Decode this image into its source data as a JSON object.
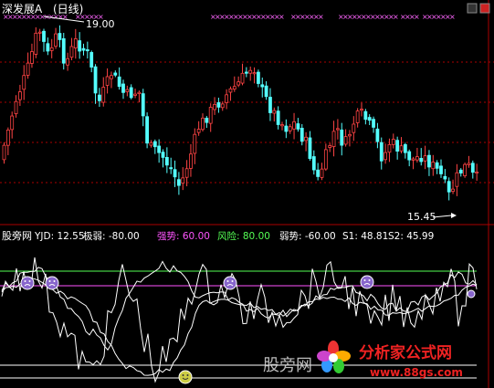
{
  "main": {
    "title": "深发展A",
    "period": "(日线)",
    "high_label": "19.00",
    "low_label": "15.45",
    "colors": {
      "up": "#ff4444",
      "down": "#54ffff",
      "marker": "#ff66ff",
      "grid": "#aa0000",
      "label": "#ffffff"
    }
  },
  "indicator": {
    "name": "股旁网",
    "items": [
      {
        "label": "YJD:",
        "value": "12.55",
        "color": "#ffffff"
      },
      {
        "label": "极弱:",
        "value": "-80.00",
        "color": "#ffffff"
      },
      {
        "label": "强势:",
        "value": "60.00",
        "color": "#ff55ff"
      },
      {
        "label": "风险:",
        "value": "80.00",
        "color": "#55ff55"
      },
      {
        "label": "弱势:",
        "value": "-60.00",
        "color": "#ffffff"
      },
      {
        "label": "S1:",
        "value": "48.81",
        "color": "#ffffff"
      },
      {
        "label": "S2:",
        "value": "45.99",
        "color": "#ffffff"
      }
    ]
  },
  "watermark": {
    "brand": "分析家公式网",
    "url": "www.88gs.com",
    "overlay_text": "股旁网"
  },
  "chart_data": {
    "type": "candlestick",
    "x_count": 120,
    "price_high": 19.0,
    "price_low": 15.45
  }
}
